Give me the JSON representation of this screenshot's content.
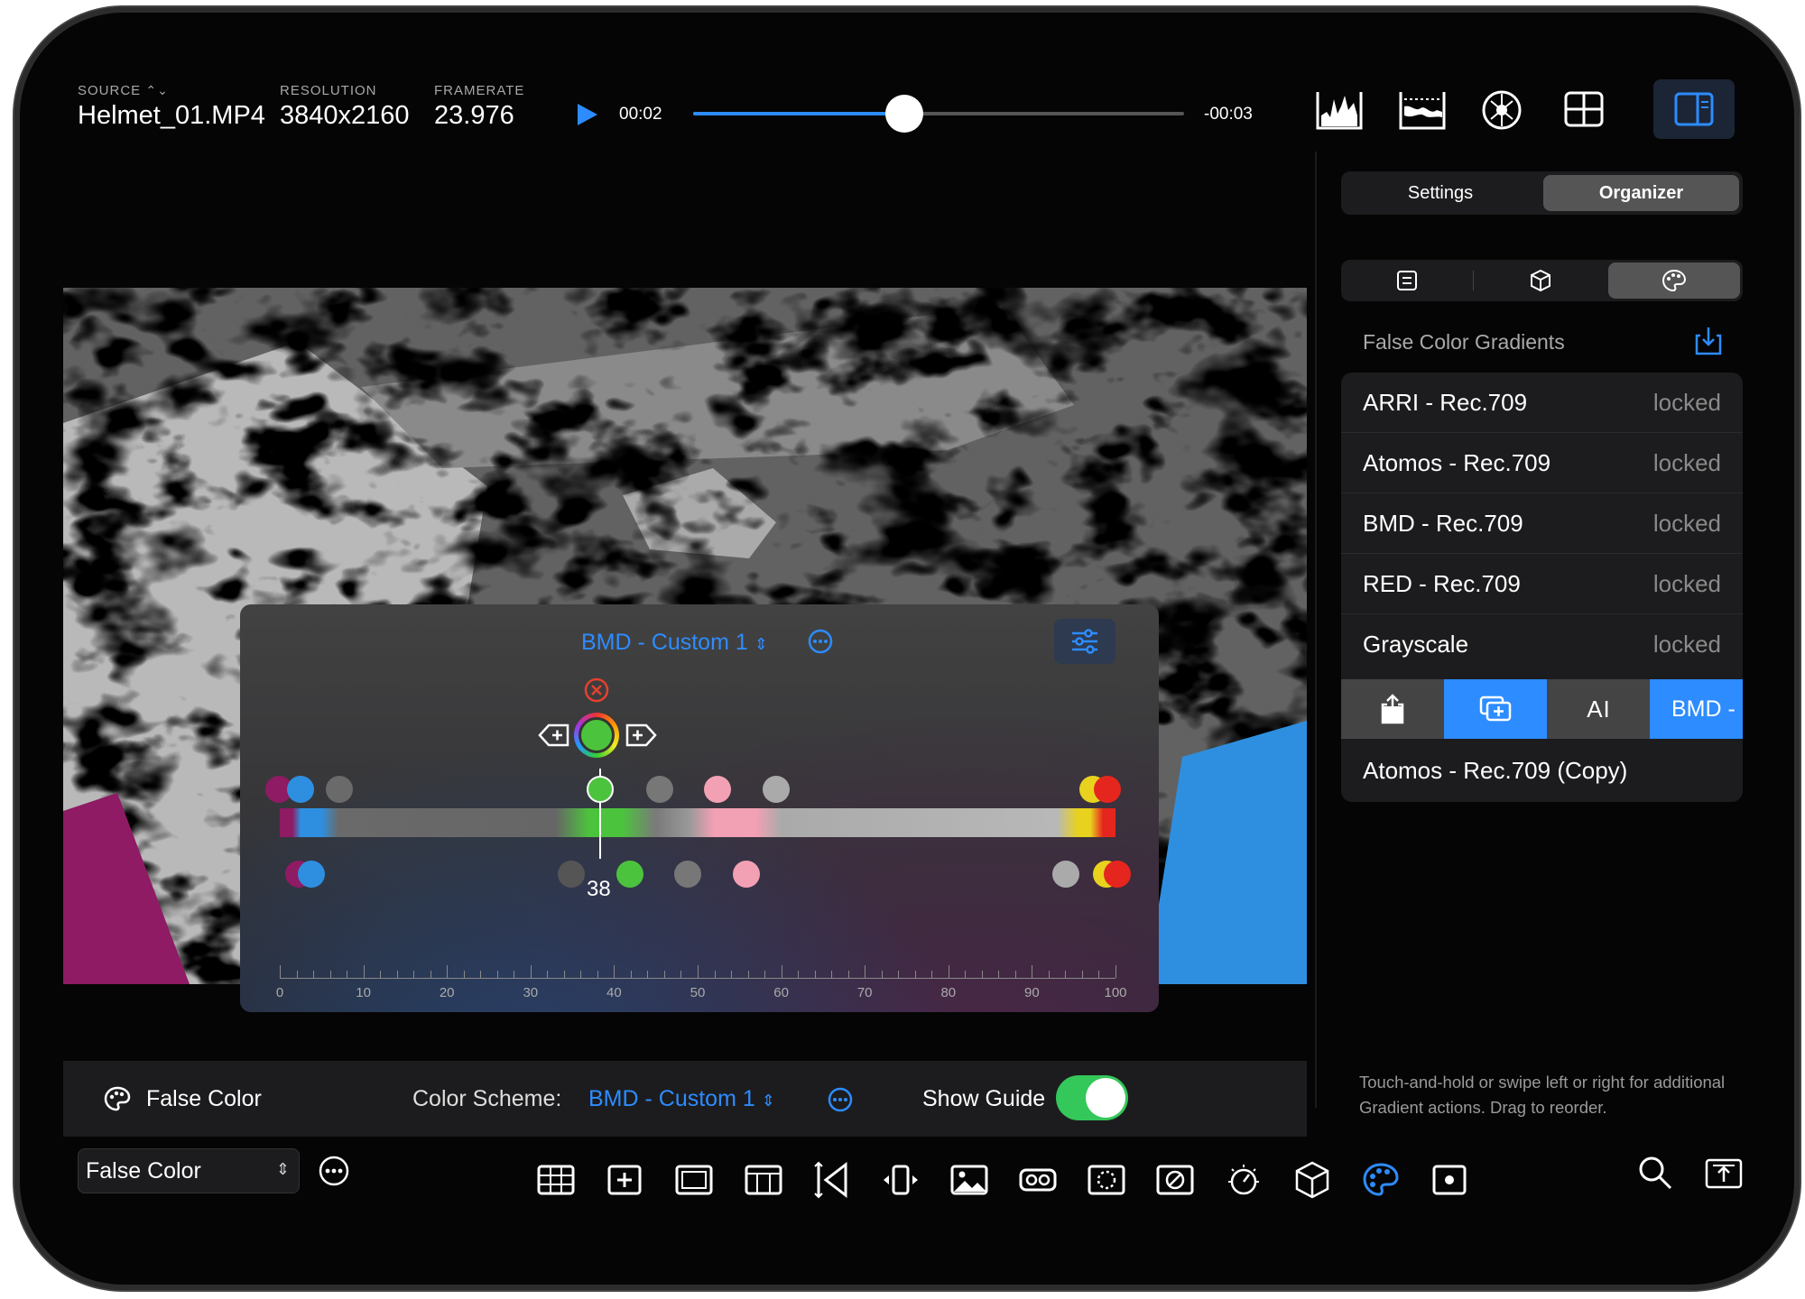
{
  "header": {
    "source_label": "SOURCE",
    "source_value": "Helmet_01.MP4",
    "resolution_label": "RESOLUTION",
    "resolution_value": "3840x2160",
    "framerate_label": "FRAMERATE",
    "framerate_value": "23.976",
    "time_elapsed": "00:02",
    "time_remaining": "-00:03",
    "playback_progress": 0.43
  },
  "panel": {
    "segment_settings": "Settings",
    "segment_organizer": "Organizer",
    "section_title": "False Color Gradients",
    "gradients": [
      {
        "name": "ARRI - Rec.709",
        "status": "locked"
      },
      {
        "name": "Atomos - Rec.709",
        "status": "locked"
      },
      {
        "name": "BMD - Rec.709",
        "status": "locked"
      },
      {
        "name": "RED - Rec.709",
        "status": "locked"
      },
      {
        "name": "Grayscale",
        "status": "locked"
      }
    ],
    "action_rename_glyph": "A",
    "action_peek_label": "BMD -",
    "copy_item": "Atomos - Rec.709 (Copy)",
    "hint": "Touch-and-hold or swipe left or right for additional Gradient actions. Drag to reorder."
  },
  "editor": {
    "scheme_title": "BMD - Custom 1",
    "selected_value": "38",
    "scale": [
      "0",
      "10",
      "20",
      "30",
      "40",
      "50",
      "60",
      "70",
      "80",
      "90",
      "100"
    ]
  },
  "bottom_bar": {
    "mode_label": "False Color",
    "scheme_label": "Color Scheme:",
    "scheme_value": "BMD - Custom 1",
    "guide_label": "Show Guide",
    "guide_on": true
  },
  "toolbar": {
    "mode_select_value": "False Color"
  },
  "colors": {
    "accent": "#2d8cff",
    "toggle_on": "#34c759",
    "fc_magenta": "#8e1b63",
    "fc_blue": "#2e8fe0",
    "fc_green": "#4cc33d",
    "fc_pink": "#f2a0b4",
    "fc_yellow": "#e8d21e",
    "fc_red": "#e5261e"
  }
}
